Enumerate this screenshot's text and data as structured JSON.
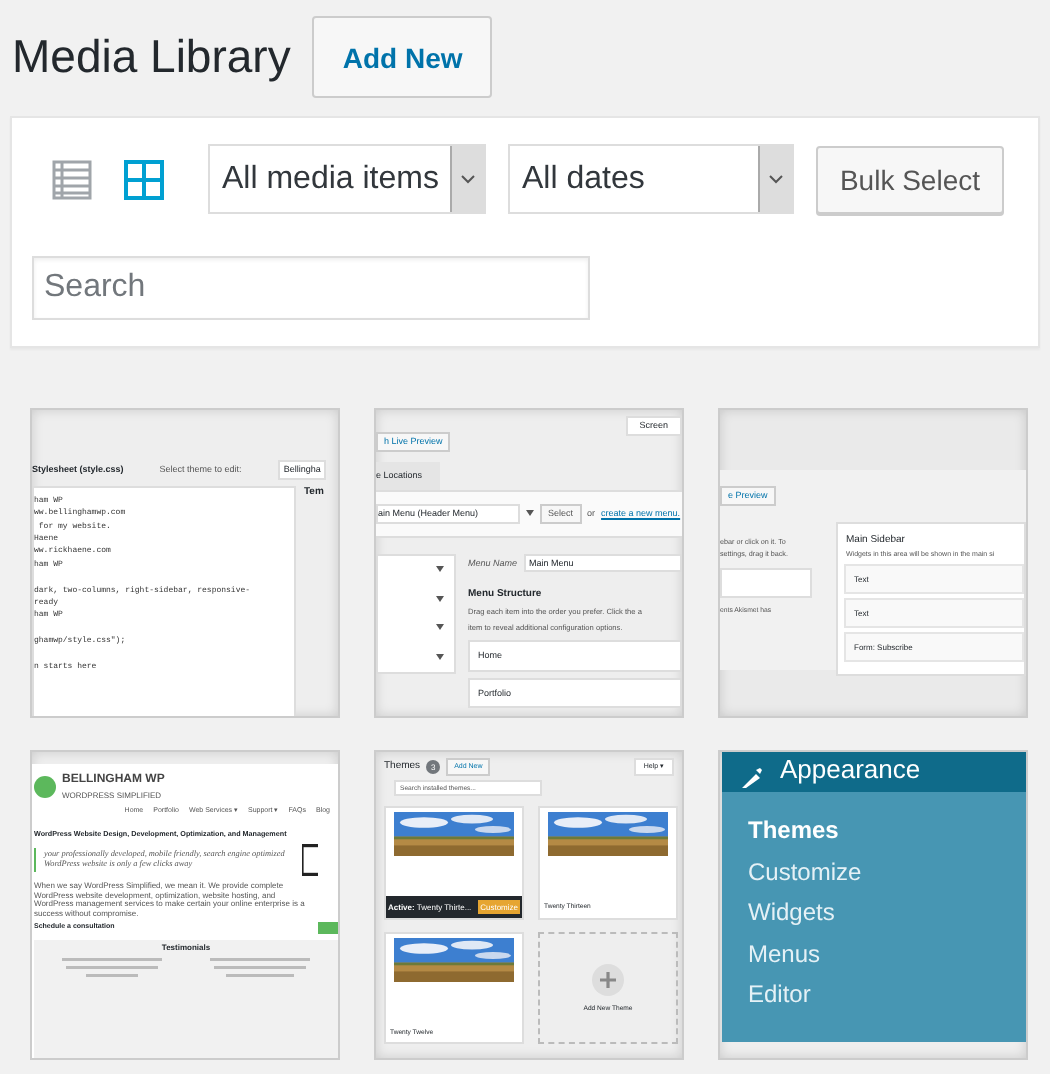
{
  "title": "Media Library",
  "add_new": "Add New",
  "view_modes": [
    {
      "kind": "list",
      "selected": false
    },
    {
      "kind": "grid",
      "selected": true
    }
  ],
  "filters": [
    {
      "value": "All media items"
    },
    {
      "value": "All dates"
    }
  ],
  "bulk_select": "Bulk Select",
  "search": {
    "placeholder": "Search"
  },
  "attachments": [
    {
      "kind": "editor",
      "heading": "Stylesheet (style.css)",
      "theme_label": "Select theme to edit:",
      "theme_value": "Bellingha",
      "side_heading": "Tem",
      "code_blocks": [
        [
          "ham WP",
          "ww.bellinghamwp.com",
          " for my website.",
          "Haene",
          "ww.rickhaene.com",
          "ham WP"
        ],
        [
          "dark, two-columns, right-sidebar, responsive-",
          "ready",
          "ham WP"
        ],
        [
          "ghamwp/style.css\");"
        ],
        [
          "n starts here"
        ]
      ]
    },
    {
      "kind": "menus",
      "preview_button": "h Live Preview",
      "screen_tab": "Screen",
      "tab": "e Locations",
      "menu_select": "ain Menu (Header Menu)",
      "select_button": "Select",
      "or": "or",
      "create_link": "create a new menu.",
      "menu_name_label": "Menu Name",
      "menu_name": "Main Menu",
      "structure_heading": "Menu Structure",
      "structure_lines": [
        "Drag each item into the order you prefer. Click the a",
        "item to reveal additional configuration options."
      ],
      "items": [
        "Home",
        "Portfolio"
      ]
    },
    {
      "kind": "widgets",
      "preview_button": "e Preview",
      "help_lines": [
        "ebar or click on it. To",
        "settings, drag it back."
      ],
      "note": "ents Akismet has",
      "sidebar_title": "Main Sidebar",
      "sidebar_desc": "Widgets in this area will be shown in the main si",
      "widgets": [
        "Text",
        "Text",
        "Form: Subscribe"
      ]
    },
    {
      "kind": "site",
      "site_name": "BELLINGHAM WP",
      "tagline": "WORDPRESS SIMPLIFIED",
      "nav": [
        "Home",
        "Portfolio",
        "Web Services ▾",
        "Support ▾",
        "FAQs",
        "Blog"
      ],
      "headline": "WordPress Website Design, Development, Optimization, and Management",
      "quote": "your professionally developed, mobile friendly, search engine optimized WordPress website is only a few clicks away",
      "body": "When we say WordPress Simplified, we mean it. We provide complete WordPress website development, optimization, website hosting, and WordPress management services to make certain your online enterprise is a success without compromise.",
      "cta": "Schedule a consultation",
      "section": "Testimonials"
    },
    {
      "kind": "themes",
      "heading": "Themes",
      "count": "3",
      "add_new": "Add New",
      "help": "Help ▾",
      "search_placeholder": "Search installed themes...",
      "active_label": "Active:",
      "active_name": "Twenty Thirte...",
      "customize": "Customize",
      "themes": [
        "Twenty Thirteen",
        "Twenty Twelve"
      ],
      "add_theme": "Add New Theme"
    },
    {
      "kind": "admin-menu",
      "heading": "Appearance",
      "items": [
        {
          "label": "Themes",
          "selected": true
        },
        {
          "label": "Customize",
          "selected": false
        },
        {
          "label": "Widgets",
          "selected": false
        },
        {
          "label": "Menus",
          "selected": false
        },
        {
          "label": "Editor",
          "selected": false
        }
      ]
    }
  ]
}
